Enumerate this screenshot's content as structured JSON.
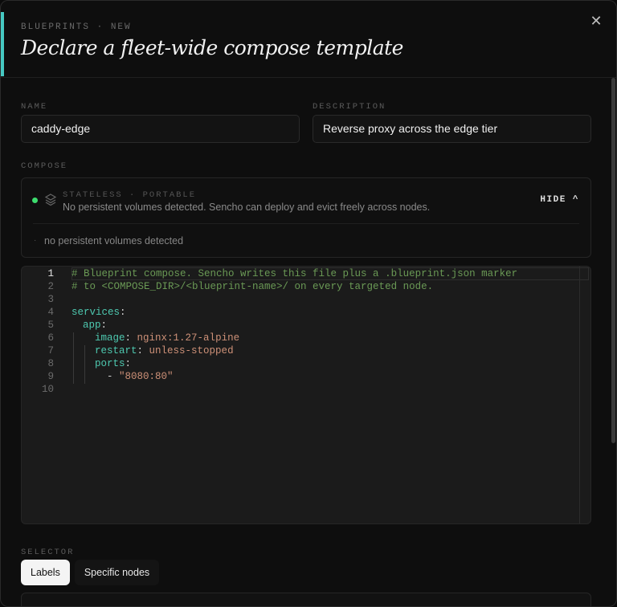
{
  "header": {
    "eyebrow": "BLUEPRINTS · NEW",
    "title": "Declare a fleet-wide compose template",
    "close_glyph": "✕"
  },
  "form": {
    "name_label": "NAME",
    "name_value": "caddy-edge",
    "description_label": "DESCRIPTION",
    "description_value": "Reverse proxy across the edge tier",
    "compose_label": "COMPOSE",
    "selector_label": "SELECTOR"
  },
  "compose_card": {
    "status_title": "STATELESS · PORTABLE",
    "status_desc": "No persistent volumes detected. Sencho can deploy and evict freely across nodes.",
    "hide_label": "HIDE ^",
    "volumes_text": "no persistent volumes detected",
    "bullet": "·"
  },
  "editor": {
    "line_numbers": [
      "1",
      "2",
      "3",
      "4",
      "5",
      "6",
      "7",
      "8",
      "9",
      "10"
    ],
    "lines": {
      "l1": "# Blueprint compose. Sencho writes this file plus a .blueprint.json marker",
      "l2": "# to <COMPOSE_DIR>/<blueprint-name>/ on every targeted node.",
      "l4_key": "services",
      "l5_key": "app",
      "l6_key": "image",
      "l6_val": "nginx:1.27-alpine",
      "l7_key": "restart",
      "l7_val": "unless-stopped",
      "l8_key": "ports",
      "l9_dash": "- ",
      "l9_val": "\"8080:80\"",
      "colon": ":"
    }
  },
  "selector_tabs": [
    {
      "label": "Labels",
      "active": true
    },
    {
      "label": "Specific nodes",
      "active": false
    }
  ],
  "colors": {
    "accent": "#46c9c3",
    "status_green": "#3ddc6e"
  },
  "icons": {
    "close": "close-icon",
    "status": "status-dot-icon",
    "layers": "layers-icon",
    "chevron": "chevron-up-icon"
  }
}
